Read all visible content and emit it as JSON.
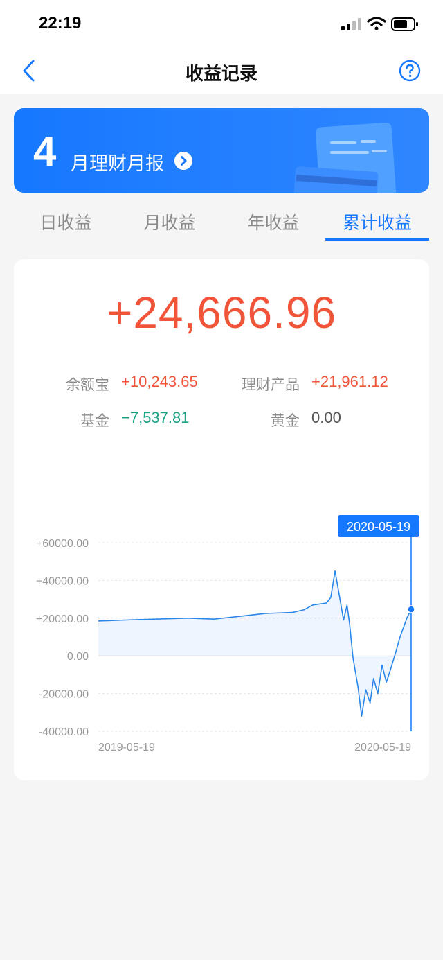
{
  "status_bar": {
    "time": "22:19",
    "icons": [
      "signal-icon",
      "wifi-icon",
      "battery-icon"
    ]
  },
  "nav": {
    "title": "收益记录",
    "back_icon": "chevron-left-icon",
    "help_icon": "help-circle-icon"
  },
  "banner": {
    "number": "4",
    "text": "月理财月报",
    "arrow_icon": "chevron-right-circle-icon"
  },
  "tabs": [
    {
      "label": "日收益",
      "active": false
    },
    {
      "label": "月收益",
      "active": false
    },
    {
      "label": "年收益",
      "active": false
    },
    {
      "label": "累计收益",
      "active": true
    }
  ],
  "summary": {
    "total": "+24,666.96",
    "items": [
      {
        "label": "余额宝",
        "value": "+10,243.65",
        "tone": "red"
      },
      {
        "label": "理财产品",
        "value": "+21,961.12",
        "tone": "red"
      },
      {
        "label": "基金",
        "value": "−7,537.81",
        "tone": "green"
      },
      {
        "label": "黄金",
        "value": "0.00",
        "tone": "gray"
      }
    ]
  },
  "colors": {
    "accent": "#1677ff",
    "gain": "#f0553a",
    "loss": "#19a282"
  },
  "chart_data": {
    "type": "area",
    "y_tick_labels": [
      "+60000.00",
      "+40000.00",
      "+20000.00",
      "0.00",
      "-20000.00",
      "-40000.00"
    ],
    "ylim": [
      -40000,
      60000
    ],
    "x_tick_labels": [
      "2019-05-19",
      "2020-05-19"
    ],
    "tooltip": "2020-05-19",
    "grid": true,
    "series": [
      {
        "x": [
          "2019-05-19",
          "2019-07-01",
          "2019-09-01",
          "2019-10-01",
          "2019-11-01",
          "2019-12-01",
          "2020-01-01",
          "2020-01-15",
          "2020-01-25",
          "2020-02-10",
          "2020-02-15",
          "2020-02-20",
          "2020-03-01",
          "2020-03-05",
          "2020-03-08",
          "2020-03-12",
          "2020-03-18",
          "2020-03-22",
          "2020-03-27",
          "2020-04-01",
          "2020-04-05",
          "2020-04-10",
          "2020-04-15",
          "2020-04-20",
          "2020-04-25",
          "2020-05-01",
          "2020-05-06",
          "2020-05-10",
          "2020-05-14",
          "2020-05-19"
        ],
        "values": [
          18500,
          19200,
          20000,
          19500,
          21000,
          22500,
          23000,
          24500,
          27000,
          28000,
          31000,
          45000,
          19000,
          27000,
          17000,
          -1000,
          -17000,
          -32000,
          -18000,
          -25000,
          -12000,
          -20000,
          -5000,
          -14000,
          -7000,
          2000,
          10000,
          15000,
          20000,
          24667
        ]
      }
    ]
  }
}
